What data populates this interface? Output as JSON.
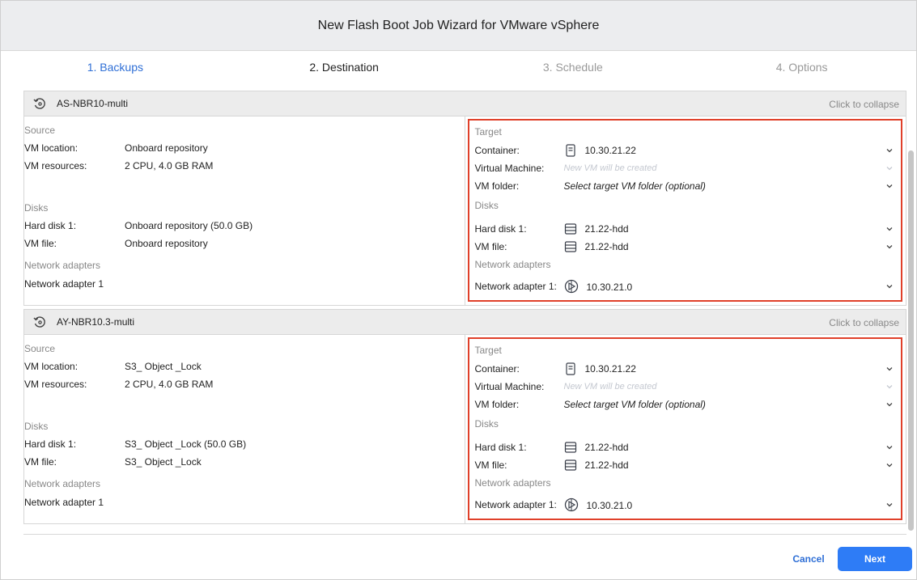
{
  "window": {
    "title": "New Flash Boot Job Wizard for VMware vSphere"
  },
  "steps": [
    {
      "label": "1. Backups",
      "state": "active"
    },
    {
      "label": "2. Destination",
      "state": "current"
    },
    {
      "label": "3. Schedule",
      "state": "pending"
    },
    {
      "label": "4. Options",
      "state": "pending"
    }
  ],
  "jobs": [
    {
      "name": "AS-NBR10-multi",
      "collapse_label": "Click to collapse",
      "source": {
        "section_title": "Source",
        "vm_location_label": "VM location:",
        "vm_location": "Onboard repository",
        "vm_resources_label": "VM resources:",
        "vm_resources": "2 CPU, 4.0 GB RAM",
        "disks_title": "Disks",
        "hard_disk_label": "Hard disk 1:",
        "hard_disk": "Onboard repository (50.0 GB)",
        "vm_file_label": "VM file:",
        "vm_file": "Onboard repository",
        "network_title": "Network adapters",
        "network_adapter": "Network adapter 1"
      },
      "target": {
        "section_title": "Target",
        "container_label": "Container:",
        "container": "10.30.21.22",
        "virtual_machine_label": "Virtual Machine:",
        "virtual_machine_placeholder": "New VM will be created",
        "vm_folder_label": "VM folder:",
        "vm_folder": "Select target VM folder (optional)",
        "disks_title": "Disks",
        "hard_disk_label": "Hard disk 1:",
        "hard_disk": "21.22-hdd",
        "vm_file_label": "VM file:",
        "vm_file": "21.22-hdd",
        "network_title": "Network adapters",
        "network_adapter_label": "Network adapter 1:",
        "network_adapter": "10.30.21.0"
      }
    },
    {
      "name": "AY-NBR10.3-multi",
      "collapse_label": "Click to collapse",
      "source": {
        "section_title": "Source",
        "vm_location_label": "VM location:",
        "vm_location": "S3_ Object _Lock",
        "vm_resources_label": "VM resources:",
        "vm_resources": "2 CPU, 4.0 GB RAM",
        "disks_title": "Disks",
        "hard_disk_label": "Hard disk 1:",
        "hard_disk": "S3_ Object _Lock (50.0 GB)",
        "vm_file_label": "VM file:",
        "vm_file": "S3_ Object _Lock",
        "network_title": "Network adapters",
        "network_adapter": "Network adapter 1"
      },
      "target": {
        "section_title": "Target",
        "container_label": "Container:",
        "container": "10.30.21.22",
        "virtual_machine_label": "Virtual Machine:",
        "virtual_machine_placeholder": "New VM will be created",
        "vm_folder_label": "VM folder:",
        "vm_folder": "Select target VM folder (optional)",
        "disks_title": "Disks",
        "hard_disk_label": "Hard disk 1:",
        "hard_disk": "21.22-hdd",
        "vm_file_label": "VM file:",
        "vm_file": "21.22-hdd",
        "network_title": "Network adapters",
        "network_adapter_label": "Network adapter 1:",
        "network_adapter": "10.30.21.0"
      }
    }
  ],
  "footer": {
    "cancel_label": "Cancel",
    "next_label": "Next"
  },
  "colors": {
    "accent": "#2f6fd6",
    "primary_button": "#2e7cf6",
    "highlight_border": "#e0402a"
  }
}
